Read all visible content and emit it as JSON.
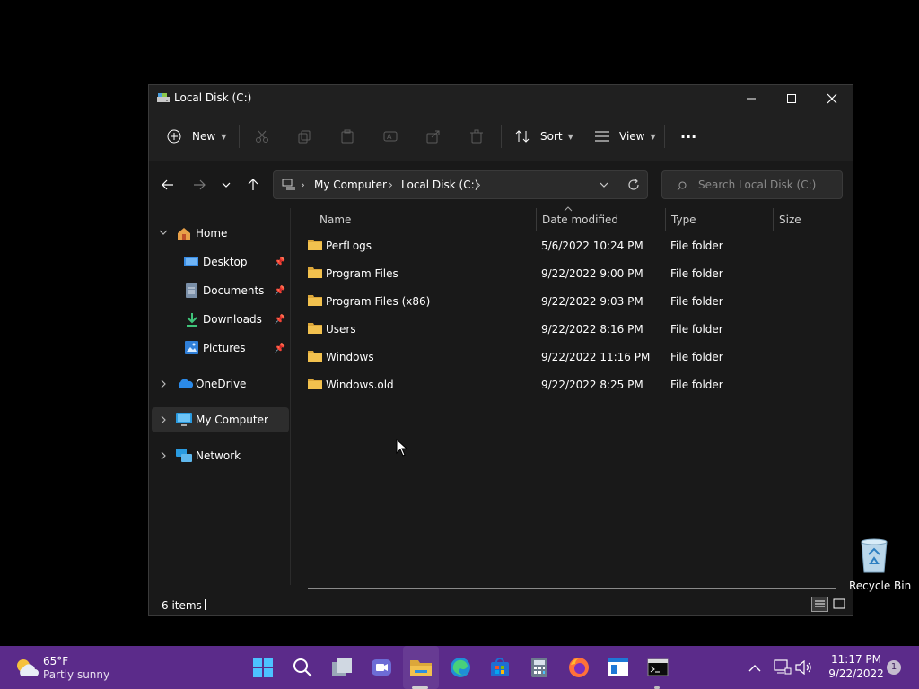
{
  "window": {
    "title": "Local Disk (C:)"
  },
  "commandbar": {
    "new_label": "New",
    "sort_label": "Sort",
    "view_label": "View",
    "more_label": "···"
  },
  "address": {
    "crumbs": [
      "My Computer",
      "Local Disk (C:)"
    ],
    "search_placeholder": "Search Local Disk (C:)"
  },
  "sidebar": {
    "items": [
      {
        "label": "Home",
        "icon": "home-icon"
      },
      {
        "label": "Desktop",
        "icon": "desktop-icon",
        "pinned": true
      },
      {
        "label": "Documents",
        "icon": "documents-icon",
        "pinned": true
      },
      {
        "label": "Downloads",
        "icon": "downloads-icon",
        "pinned": true
      },
      {
        "label": "Pictures",
        "icon": "pictures-icon",
        "pinned": true
      },
      {
        "label": "OneDrive",
        "icon": "onedrive-icon"
      },
      {
        "label": "My Computer",
        "icon": "computer-icon",
        "selected": true
      },
      {
        "label": "Network",
        "icon": "network-icon"
      }
    ]
  },
  "columns": {
    "name": "Name",
    "date": "Date modified",
    "type": "Type",
    "size": "Size"
  },
  "files": [
    {
      "name": "PerfLogs",
      "date": "5/6/2022 10:24 PM",
      "type": "File folder"
    },
    {
      "name": "Program Files",
      "date": "9/22/2022 9:00 PM",
      "type": "File folder"
    },
    {
      "name": "Program Files (x86)",
      "date": "9/22/2022 9:03 PM",
      "type": "File folder"
    },
    {
      "name": "Users",
      "date": "9/22/2022 8:16 PM",
      "type": "File folder"
    },
    {
      "name": "Windows",
      "date": "9/22/2022 11:16 PM",
      "type": "File folder"
    },
    {
      "name": "Windows.old",
      "date": "9/22/2022 8:25 PM",
      "type": "File folder"
    }
  ],
  "status": {
    "items": "6 items"
  },
  "desktop": {
    "recycle_label": "Recycle Bin"
  },
  "taskbar": {
    "weather_temp": "65°F",
    "weather_desc": "Partly sunny",
    "time": "11:17 PM",
    "date": "9/22/2022",
    "notifications": "1"
  },
  "colors": {
    "taskbar": "#5b2b8a",
    "folder": "#f2c14e",
    "window_bg": "#191919"
  }
}
